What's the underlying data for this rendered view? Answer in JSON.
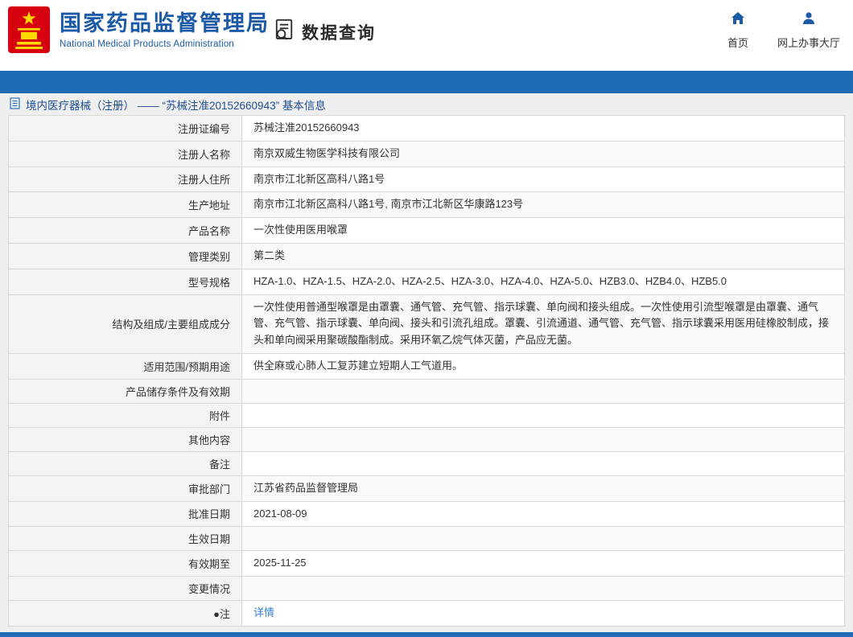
{
  "header": {
    "title": "国家药品监督管理局",
    "subtitle": "National Medical Products Administration",
    "section_label": "数据查询",
    "nav": [
      {
        "label": "首页",
        "icon": "home-icon"
      },
      {
        "label": "网上办事大厅",
        "icon": "user-icon"
      }
    ]
  },
  "breadcrumb": {
    "text": "境内医疗器械（注册） —— “苏械注准20152660943” 基本信息"
  },
  "table": {
    "rows": [
      {
        "label": "注册证编号",
        "value": "苏械注准20152660943"
      },
      {
        "label": "注册人名称",
        "value": "南京双威生物医学科技有限公司"
      },
      {
        "label": "注册人住所",
        "value": "南京市江北新区高科八路1号"
      },
      {
        "label": "生产地址",
        "value": "南京市江北新区高科八路1号, 南京市江北新区华康路123号"
      },
      {
        "label": "产品名称",
        "value": "一次性使用医用喉罩"
      },
      {
        "label": "管理类别",
        "value": "第二类"
      },
      {
        "label": "型号规格",
        "value": "HZA-1.0、HZA-1.5、HZA-2.0、HZA-2.5、HZA-3.0、HZA-4.0、HZA-5.0、HZB3.0、HZB4.0、HZB5.0"
      },
      {
        "label": "结构及组成/主要组成成分",
        "value": "一次性使用普通型喉罩是由罩囊、通气管、充气管、指示球囊、单向阀和接头组成。一次性使用引流型喉罩是由罩囊、通气管、充气管、指示球囊、单向阀、接头和引流孔组成。罩囊、引流通道、通气管、充气管、指示球囊采用医用硅橡胶制成，接头和单向阀采用聚碳酸酯制成。采用环氧乙烷气体灭菌，产品应无菌。"
      },
      {
        "label": "适用范围/预期用途",
        "value": "供全麻或心肺人工复苏建立短期人工气道用。"
      },
      {
        "label": "产品储存条件及有效期",
        "value": ""
      },
      {
        "label": "附件",
        "value": ""
      },
      {
        "label": "其他内容",
        "value": ""
      },
      {
        "label": "备注",
        "value": ""
      },
      {
        "label": "审批部门",
        "value": "江苏省药品监督管理局"
      },
      {
        "label": "批准日期",
        "value": "2021-08-09"
      },
      {
        "label": "生效日期",
        "value": ""
      },
      {
        "label": "有效期至",
        "value": "2025-11-25"
      },
      {
        "label": "变更情况",
        "value": ""
      },
      {
        "label": "●注",
        "value": "详情",
        "link": true
      }
    ]
  },
  "colors": {
    "accent_blue": "#1b5aa6",
    "bar_blue": "#1e6cb5",
    "link_blue": "#2f80d0",
    "emblem_red": "#d7000f",
    "emblem_gold": "#ffd700",
    "label_bg": "#f4f4f4"
  }
}
